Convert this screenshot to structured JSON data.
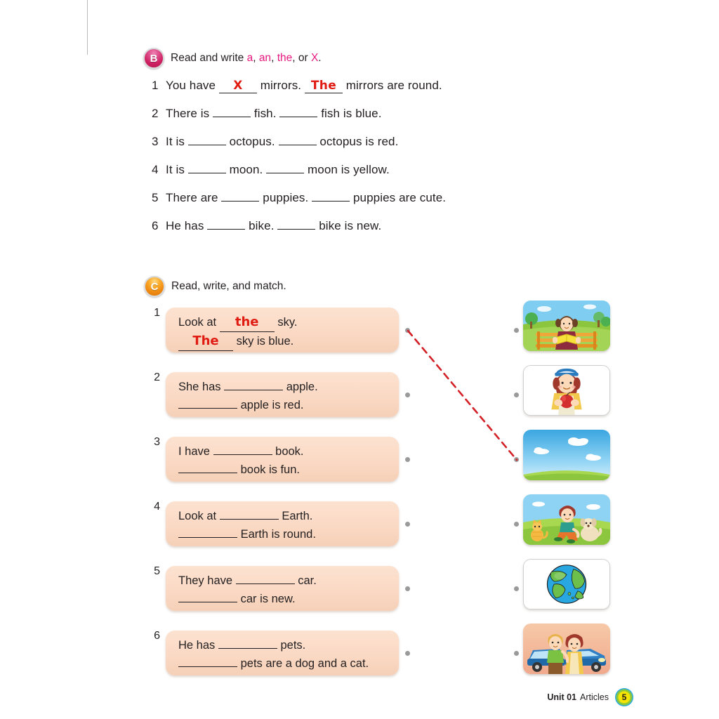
{
  "section_b": {
    "badge": "B",
    "instruction_prefix": "Read and write ",
    "kw_a": "a",
    "sep1": ", ",
    "kw_an": "an",
    "sep2": ", ",
    "kw_the": "the",
    "sep3": ", or ",
    "kw_x": "X",
    "sep4": ".",
    "items": [
      {
        "num": "1",
        "pre": "You have",
        "answer1": "X",
        "mid": "mirrors.",
        "answer2": "The",
        "post": "mirrors are round."
      },
      {
        "num": "2",
        "pre": "There is",
        "answer1": "",
        "mid": "fish.",
        "answer2": "",
        "post": "fish is blue."
      },
      {
        "num": "3",
        "pre": "It is",
        "answer1": "",
        "mid": "octopus.",
        "answer2": "",
        "post": "octopus is red."
      },
      {
        "num": "4",
        "pre": "It is",
        "answer1": "",
        "mid": "moon.",
        "answer2": "",
        "post": "moon is yellow."
      },
      {
        "num": "5",
        "pre": "There are",
        "answer1": "",
        "mid": "puppies.",
        "answer2": "",
        "post": "puppies are cute."
      },
      {
        "num": "6",
        "pre": "He has",
        "answer1": "",
        "mid": "bike.",
        "answer2": "",
        "post": "bike is new."
      }
    ]
  },
  "section_c": {
    "badge": "C",
    "instruction": "Read, write, and match.",
    "items": [
      {
        "num": "1",
        "line1_pre": "Look at",
        "line1_answer": "the",
        "line1_post": "sky.",
        "line2_answer": "The",
        "line2_post": "sky is blue."
      },
      {
        "num": "2",
        "line1_pre": "She has",
        "line1_answer": "",
        "line1_post": "apple.",
        "line2_answer": "",
        "line2_post": "apple is red."
      },
      {
        "num": "3",
        "line1_pre": "I have",
        "line1_answer": "",
        "line1_post": "book.",
        "line2_answer": "",
        "line2_post": "book is fun."
      },
      {
        "num": "4",
        "line1_pre": "Look at",
        "line1_answer": "",
        "line1_post": "Earth.",
        "line2_answer": "",
        "line2_post": "Earth is round."
      },
      {
        "num": "5",
        "line1_pre": "They have",
        "line1_answer": "",
        "line1_post": "car.",
        "line2_answer": "",
        "line2_post": "car is new."
      },
      {
        "num": "6",
        "line1_pre": "He has",
        "line1_answer": "",
        "line1_post": "pets.",
        "line2_answer": "",
        "line2_post": "pets are a dog and a cat."
      }
    ],
    "pictures": [
      {
        "name": "girl-reading-book-on-bench",
        "style": "scene"
      },
      {
        "name": "girl-holding-red-apple",
        "style": "plain"
      },
      {
        "name": "blue-sky-over-green-field",
        "style": "scene"
      },
      {
        "name": "boy-with-cat-and-dog",
        "style": "scene"
      },
      {
        "name": "earth-globe",
        "style": "plain"
      },
      {
        "name": "couple-with-blue-car",
        "style": "scene"
      }
    ],
    "match_line_color": "#d42027"
  },
  "footer": {
    "unit": "Unit 01",
    "topic": "Articles",
    "page_number": "5"
  }
}
